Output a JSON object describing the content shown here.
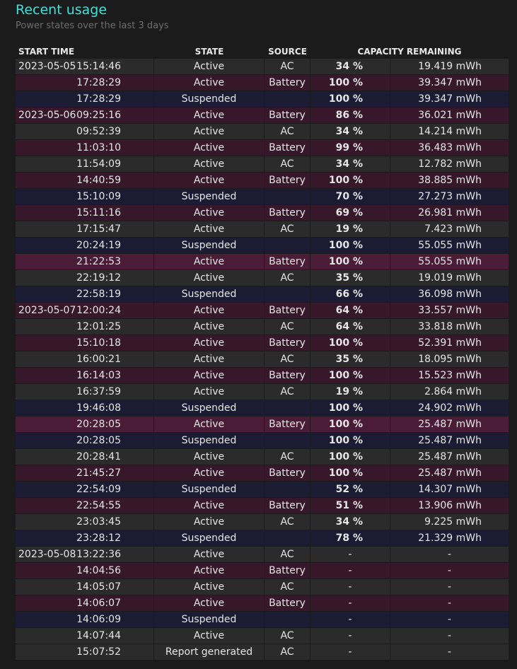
{
  "header": {
    "title": "Recent usage",
    "subtitle": "Power states over the last 3 days"
  },
  "table": {
    "columns": [
      "START TIME",
      "STATE",
      "SOURCE",
      "CAPACITY REMAINING"
    ],
    "rows": [
      {
        "date": "2023-05-05",
        "time": "15:14:46",
        "state": "Active",
        "source": "AC",
        "pct": "34 %",
        "mwh": "19.419 mWh",
        "kind": "ac"
      },
      {
        "date": "",
        "time": "17:28:29",
        "state": "Active",
        "source": "Battery",
        "pct": "100 %",
        "mwh": "39.347 mWh",
        "kind": "battery"
      },
      {
        "date": "",
        "time": "17:28:29",
        "state": "Suspended",
        "source": "",
        "pct": "100 %",
        "mwh": "39.347 mWh",
        "kind": "suspended"
      },
      {
        "date": "2023-05-06",
        "time": "09:25:16",
        "state": "Active",
        "source": "Battery",
        "pct": "86 %",
        "mwh": "36.021 mWh",
        "kind": "battery"
      },
      {
        "date": "",
        "time": "09:52:39",
        "state": "Active",
        "source": "AC",
        "pct": "34 %",
        "mwh": "14.214 mWh",
        "kind": "ac"
      },
      {
        "date": "",
        "time": "11:03:10",
        "state": "Active",
        "source": "Battery",
        "pct": "99 %",
        "mwh": "36.483 mWh",
        "kind": "battery"
      },
      {
        "date": "",
        "time": "11:54:09",
        "state": "Active",
        "source": "AC",
        "pct": "34 %",
        "mwh": "12.782 mWh",
        "kind": "ac"
      },
      {
        "date": "",
        "time": "14:40:59",
        "state": "Active",
        "source": "Battery",
        "pct": "100 %",
        "mwh": "38.885 mWh",
        "kind": "battery"
      },
      {
        "date": "",
        "time": "15:10:09",
        "state": "Suspended",
        "source": "",
        "pct": "70 %",
        "mwh": "27.273 mWh",
        "kind": "suspended"
      },
      {
        "date": "",
        "time": "15:11:16",
        "state": "Active",
        "source": "Battery",
        "pct": "69 %",
        "mwh": "26.981 mWh",
        "kind": "battery"
      },
      {
        "date": "",
        "time": "17:15:47",
        "state": "Active",
        "source": "AC",
        "pct": "19 %",
        "mwh": "7.423 mWh",
        "kind": "ac"
      },
      {
        "date": "",
        "time": "20:24:19",
        "state": "Suspended",
        "source": "",
        "pct": "100 %",
        "mwh": "55.055 mWh",
        "kind": "suspended"
      },
      {
        "date": "",
        "time": "21:22:53",
        "state": "Active",
        "source": "Battery",
        "pct": "100 %",
        "mwh": "55.055 mWh",
        "kind": "hl"
      },
      {
        "date": "",
        "time": "22:19:12",
        "state": "Active",
        "source": "AC",
        "pct": "35 %",
        "mwh": "19.019 mWh",
        "kind": "ac"
      },
      {
        "date": "",
        "time": "22:58:19",
        "state": "Suspended",
        "source": "",
        "pct": "66 %",
        "mwh": "36.098 mWh",
        "kind": "suspended"
      },
      {
        "date": "2023-05-07",
        "time": "12:00:24",
        "state": "Active",
        "source": "Battery",
        "pct": "64 %",
        "mwh": "33.557 mWh",
        "kind": "battery"
      },
      {
        "date": "",
        "time": "12:01:25",
        "state": "Active",
        "source": "AC",
        "pct": "64 %",
        "mwh": "33.818 mWh",
        "kind": "ac"
      },
      {
        "date": "",
        "time": "15:10:18",
        "state": "Active",
        "source": "Battery",
        "pct": "100 %",
        "mwh": "52.391 mWh",
        "kind": "battery"
      },
      {
        "date": "",
        "time": "16:00:21",
        "state": "Active",
        "source": "AC",
        "pct": "35 %",
        "mwh": "18.095 mWh",
        "kind": "ac"
      },
      {
        "date": "",
        "time": "16:14:03",
        "state": "Active",
        "source": "Battery",
        "pct": "100 %",
        "mwh": "15.523 mWh",
        "kind": "battery"
      },
      {
        "date": "",
        "time": "16:37:59",
        "state": "Active",
        "source": "AC",
        "pct": "19 %",
        "mwh": "2.864 mWh",
        "kind": "ac"
      },
      {
        "date": "",
        "time": "19:46:08",
        "state": "Suspended",
        "source": "",
        "pct": "100 %",
        "mwh": "24.902 mWh",
        "kind": "suspended"
      },
      {
        "date": "",
        "time": "20:28:05",
        "state": "Active",
        "source": "Battery",
        "pct": "100 %",
        "mwh": "25.487 mWh",
        "kind": "hl"
      },
      {
        "date": "",
        "time": "20:28:05",
        "state": "Suspended",
        "source": "",
        "pct": "100 %",
        "mwh": "25.487 mWh",
        "kind": "suspended"
      },
      {
        "date": "",
        "time": "20:28:41",
        "state": "Active",
        "source": "AC",
        "pct": "100 %",
        "mwh": "25.487 mWh",
        "kind": "ac"
      },
      {
        "date": "",
        "time": "21:45:27",
        "state": "Active",
        "source": "Battery",
        "pct": "100 %",
        "mwh": "25.487 mWh",
        "kind": "battery"
      },
      {
        "date": "",
        "time": "22:54:09",
        "state": "Suspended",
        "source": "",
        "pct": "52 %",
        "mwh": "14.307 mWh",
        "kind": "suspended"
      },
      {
        "date": "",
        "time": "22:54:55",
        "state": "Active",
        "source": "Battery",
        "pct": "51 %",
        "mwh": "13.906 mWh",
        "kind": "battery"
      },
      {
        "date": "",
        "time": "23:03:45",
        "state": "Active",
        "source": "AC",
        "pct": "34 %",
        "mwh": "9.225 mWh",
        "kind": "ac"
      },
      {
        "date": "",
        "time": "23:28:12",
        "state": "Suspended",
        "source": "",
        "pct": "78 %",
        "mwh": "21.329 mWh",
        "kind": "suspended"
      },
      {
        "date": "2023-05-08",
        "time": "13:22:36",
        "state": "Active",
        "source": "AC",
        "pct": "-",
        "mwh": "-",
        "kind": "ac"
      },
      {
        "date": "",
        "time": "14:04:56",
        "state": "Active",
        "source": "Battery",
        "pct": "-",
        "mwh": "-",
        "kind": "battery"
      },
      {
        "date": "",
        "time": "14:05:07",
        "state": "Active",
        "source": "AC",
        "pct": "-",
        "mwh": "-",
        "kind": "ac"
      },
      {
        "date": "",
        "time": "14:06:07",
        "state": "Active",
        "source": "Battery",
        "pct": "-",
        "mwh": "-",
        "kind": "battery"
      },
      {
        "date": "",
        "time": "14:06:09",
        "state": "Suspended",
        "source": "",
        "pct": "-",
        "mwh": "-",
        "kind": "suspended"
      },
      {
        "date": "",
        "time": "14:07:44",
        "state": "Active",
        "source": "AC",
        "pct": "-",
        "mwh": "-",
        "kind": "ac"
      },
      {
        "date": "",
        "time": "15:07:52",
        "state": "Report generated",
        "source": "AC",
        "pct": "-",
        "mwh": "-",
        "kind": "report"
      }
    ]
  }
}
